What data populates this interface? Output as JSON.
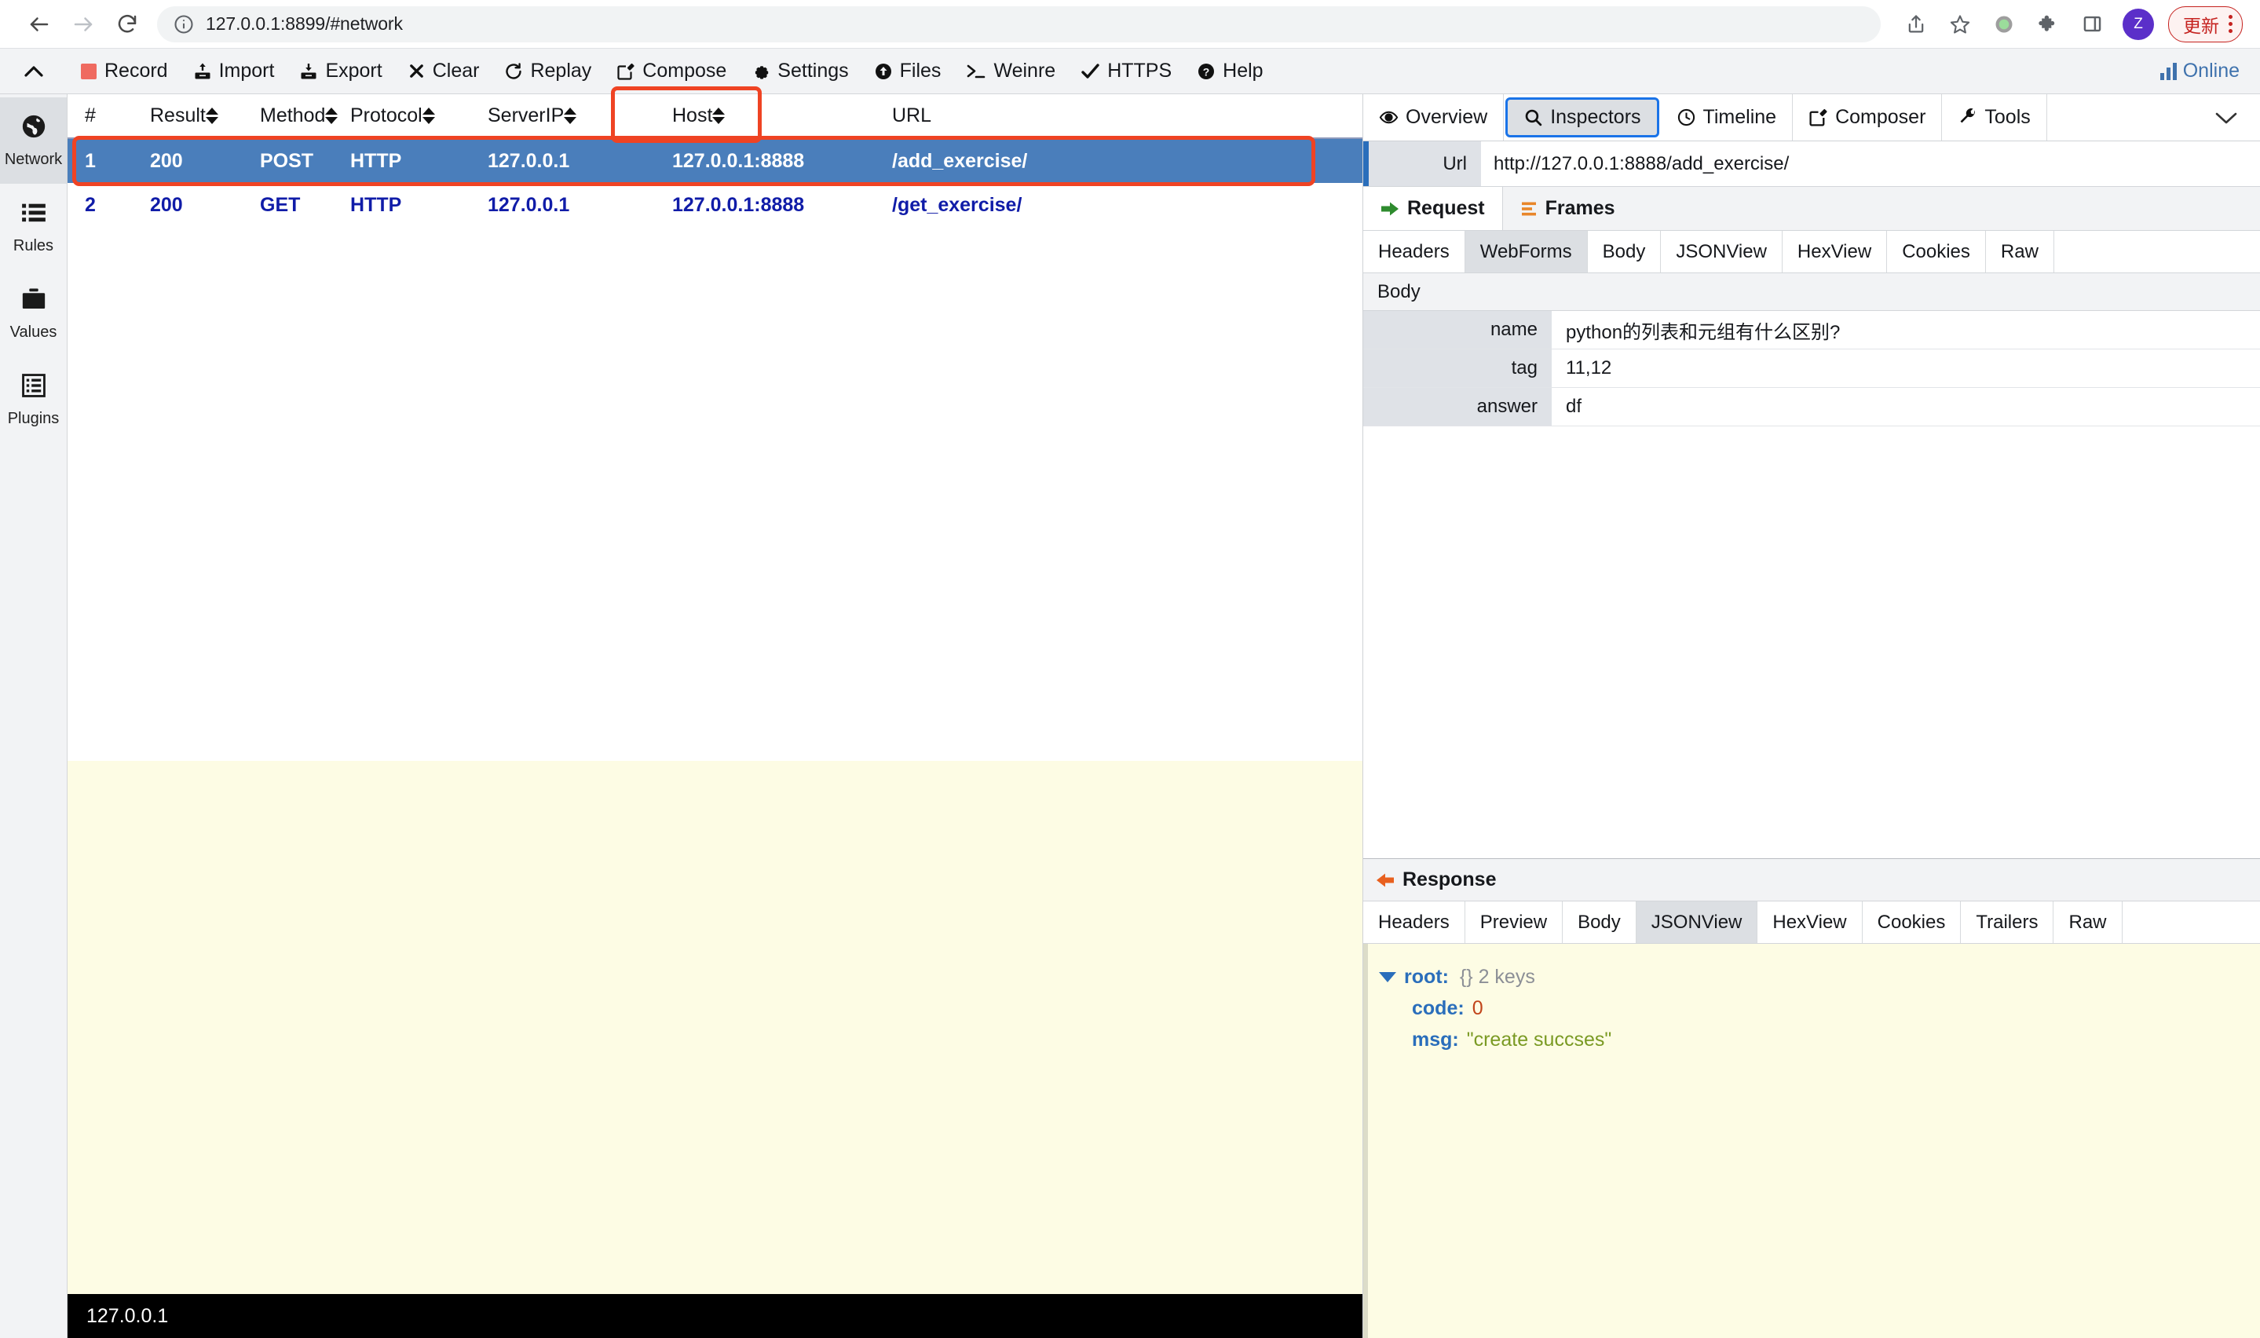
{
  "browser": {
    "url": "127.0.0.1:8899/#network",
    "back_icon": "back-arrow-icon",
    "forward_icon": "forward-arrow-icon",
    "reload_icon": "reload-icon",
    "site_info_icon": "site-info-icon",
    "share_icon": "share-icon",
    "bookmark_icon": "star-icon",
    "extension_green_icon": "green-dot-extension-icon",
    "puzzle_icon": "puzzle-extensions-icon",
    "sidepanel_icon": "side-panel-icon",
    "avatar_letter": "Z",
    "update_label": "更新",
    "menu_icon": "three-dot-menu-icon"
  },
  "toolbar": {
    "collapse_icon": "chevron-up-icon",
    "items": [
      {
        "label": "Record",
        "icon": "record-square-icon"
      },
      {
        "label": "Import",
        "icon": "import-icon"
      },
      {
        "label": "Export",
        "icon": "export-icon"
      },
      {
        "label": "Clear",
        "icon": "x-clear-icon"
      },
      {
        "label": "Replay",
        "icon": "replay-refresh-icon"
      },
      {
        "label": "Compose",
        "icon": "compose-pencil-icon"
      },
      {
        "label": "Settings",
        "icon": "gear-icon"
      },
      {
        "label": "Files",
        "icon": "upload-circle-icon"
      },
      {
        "label": "Weinre",
        "icon": "terminal-prompt-icon"
      },
      {
        "label": "HTTPS",
        "icon": "check-icon"
      },
      {
        "label": "Help",
        "icon": "help-question-icon"
      }
    ],
    "online_label": "Online",
    "online_icon": "signal-bars-icon",
    "highlight_color": "#ef4323"
  },
  "rail": {
    "items": [
      {
        "label": "Network",
        "icon": "globe-icon",
        "active": true
      },
      {
        "label": "Rules",
        "icon": "list-icon",
        "active": false
      },
      {
        "label": "Values",
        "icon": "briefcase-icon",
        "active": false
      },
      {
        "label": "Plugins",
        "icon": "plugins-list-icon",
        "active": false
      }
    ]
  },
  "session_grid": {
    "columns": [
      "#",
      "Result",
      "Method",
      "Protocol",
      "ServerIP",
      "Host",
      "URL"
    ],
    "sortable": [
      false,
      true,
      true,
      true,
      true,
      true,
      true
    ],
    "rows": [
      {
        "index": "1",
        "result": "200",
        "method": "POST",
        "protocol": "HTTP",
        "serverip": "127.0.0.1",
        "host": "127.0.0.1:8888",
        "url": "/add_exercise/",
        "selected": true
      },
      {
        "index": "2",
        "result": "200",
        "method": "GET",
        "protocol": "HTTP",
        "serverip": "127.0.0.1",
        "host": "127.0.0.1:8888",
        "url": "/get_exercise/",
        "selected": false
      }
    ],
    "status_bar": "127.0.0.1",
    "selected_row_color": "#4a7ebb",
    "row_text_color": "#101ca8"
  },
  "inspector": {
    "tabs": [
      {
        "label": "Overview",
        "icon": "eye-icon",
        "active": false
      },
      {
        "label": "Inspectors",
        "icon": "magnifier-icon",
        "active": true
      },
      {
        "label": "Timeline",
        "icon": "clock-icon",
        "active": false
      },
      {
        "label": "Composer",
        "icon": "compose-pencil-icon",
        "active": false
      },
      {
        "label": "Tools",
        "icon": "wrench-icon",
        "active": false
      }
    ],
    "expand_icon": "chevron-down-icon",
    "url_label": "Url",
    "url_value": "http://127.0.0.1:8888/add_exercise/",
    "request": {
      "subtabs": [
        {
          "label": "Request",
          "icon": "green-right-arrow-icon",
          "selected": true
        },
        {
          "label": "Frames",
          "icon": "orange-frames-icon",
          "selected": false
        }
      ],
      "view_tabs": [
        {
          "label": "Headers",
          "selected": false
        },
        {
          "label": "WebForms",
          "selected": true
        },
        {
          "label": "Body",
          "selected": false
        },
        {
          "label": "JSONView",
          "selected": false
        },
        {
          "label": "HexView",
          "selected": false
        },
        {
          "label": "Cookies",
          "selected": false
        },
        {
          "label": "Raw",
          "selected": false
        }
      ],
      "section_title": "Body",
      "fields": [
        {
          "key": "name",
          "value": "python的列表和元组有什么区别?"
        },
        {
          "key": "tag",
          "value": "11,12"
        },
        {
          "key": "answer",
          "value": "df"
        }
      ]
    },
    "response": {
      "title": "Response",
      "title_icon": "orange-left-arrow-icon",
      "view_tabs": [
        {
          "label": "Headers",
          "selected": false
        },
        {
          "label": "Preview",
          "selected": false
        },
        {
          "label": "Body",
          "selected": false
        },
        {
          "label": "JSONView",
          "selected": true
        },
        {
          "label": "HexView",
          "selected": false
        },
        {
          "label": "Cookies",
          "selected": false
        },
        {
          "label": "Trailers",
          "selected": false
        },
        {
          "label": "Raw",
          "selected": false
        }
      ],
      "json": {
        "root_label": "root:",
        "root_meta": "{} 2 keys",
        "entries": [
          {
            "key": "code:",
            "value": "0",
            "kind": "number"
          },
          {
            "key": "msg:",
            "value": "\"create succses\"",
            "kind": "string"
          }
        ]
      }
    }
  }
}
